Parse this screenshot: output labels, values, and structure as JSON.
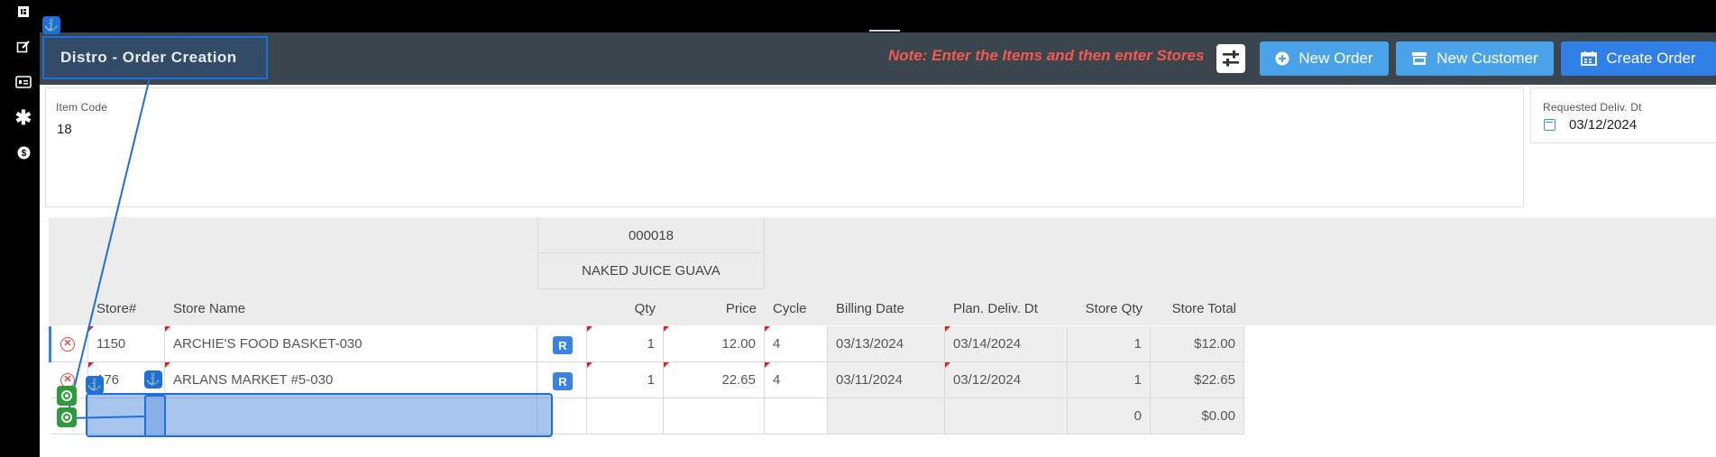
{
  "rail": {
    "icons": [
      "logo-icon",
      "edit-icon",
      "id-card-icon",
      "asterisk-icon",
      "dollar-icon"
    ]
  },
  "header": {
    "title": "Distro - Order Creation",
    "note": "Note: Enter the Items and then enter Stores",
    "buttons": {
      "new_order": "New Order",
      "new_customer": "New Customer",
      "create_order": "Create Order"
    }
  },
  "form": {
    "item_code_label": "Item Code",
    "item_code_value": "18",
    "req_deliv_label": "Requested Deliv. Dt",
    "req_deliv_value": "03/12/2024"
  },
  "grid": {
    "item_code": "000018",
    "item_name": "NAKED JUICE GUAVA",
    "columns": {
      "store_no": "Store#",
      "store_name": "Store Name",
      "qty": "Qty",
      "price": "Price",
      "cycle": "Cycle",
      "billing_date": "Billing Date",
      "plan_deliv": "Plan. Deliv. Dt",
      "store_qty": "Store Qty",
      "store_total": "Store Total"
    },
    "rows": [
      {
        "store_no": "1150",
        "store_name": "ARCHIE'S FOOD BASKET-030",
        "badge": "R",
        "qty": "1",
        "price": "12.00",
        "cycle": "4",
        "billing_date": "03/13/2024",
        "plan_deliv": "03/14/2024",
        "store_qty": "1",
        "store_total": "$12.00"
      },
      {
        "store_no": "176",
        "store_name": "ARLANS MARKET #5-030",
        "badge": "R",
        "qty": "1",
        "price": "22.65",
        "cycle": "4",
        "billing_date": "03/11/2024",
        "plan_deliv": "03/12/2024",
        "store_qty": "1",
        "store_total": "$22.65"
      },
      {
        "store_no": "",
        "store_name": "",
        "badge": "",
        "qty": "",
        "price": "",
        "cycle": "",
        "billing_date": "",
        "plan_deliv": "",
        "store_qty": "0",
        "store_total": "$0.00"
      }
    ]
  },
  "colors": {
    "header_bg": "#3b454e",
    "accent": "#4aa3e9",
    "primary": "#2f7fe6",
    "note": "#f25a4d",
    "title_border": "#1e6fd9"
  }
}
